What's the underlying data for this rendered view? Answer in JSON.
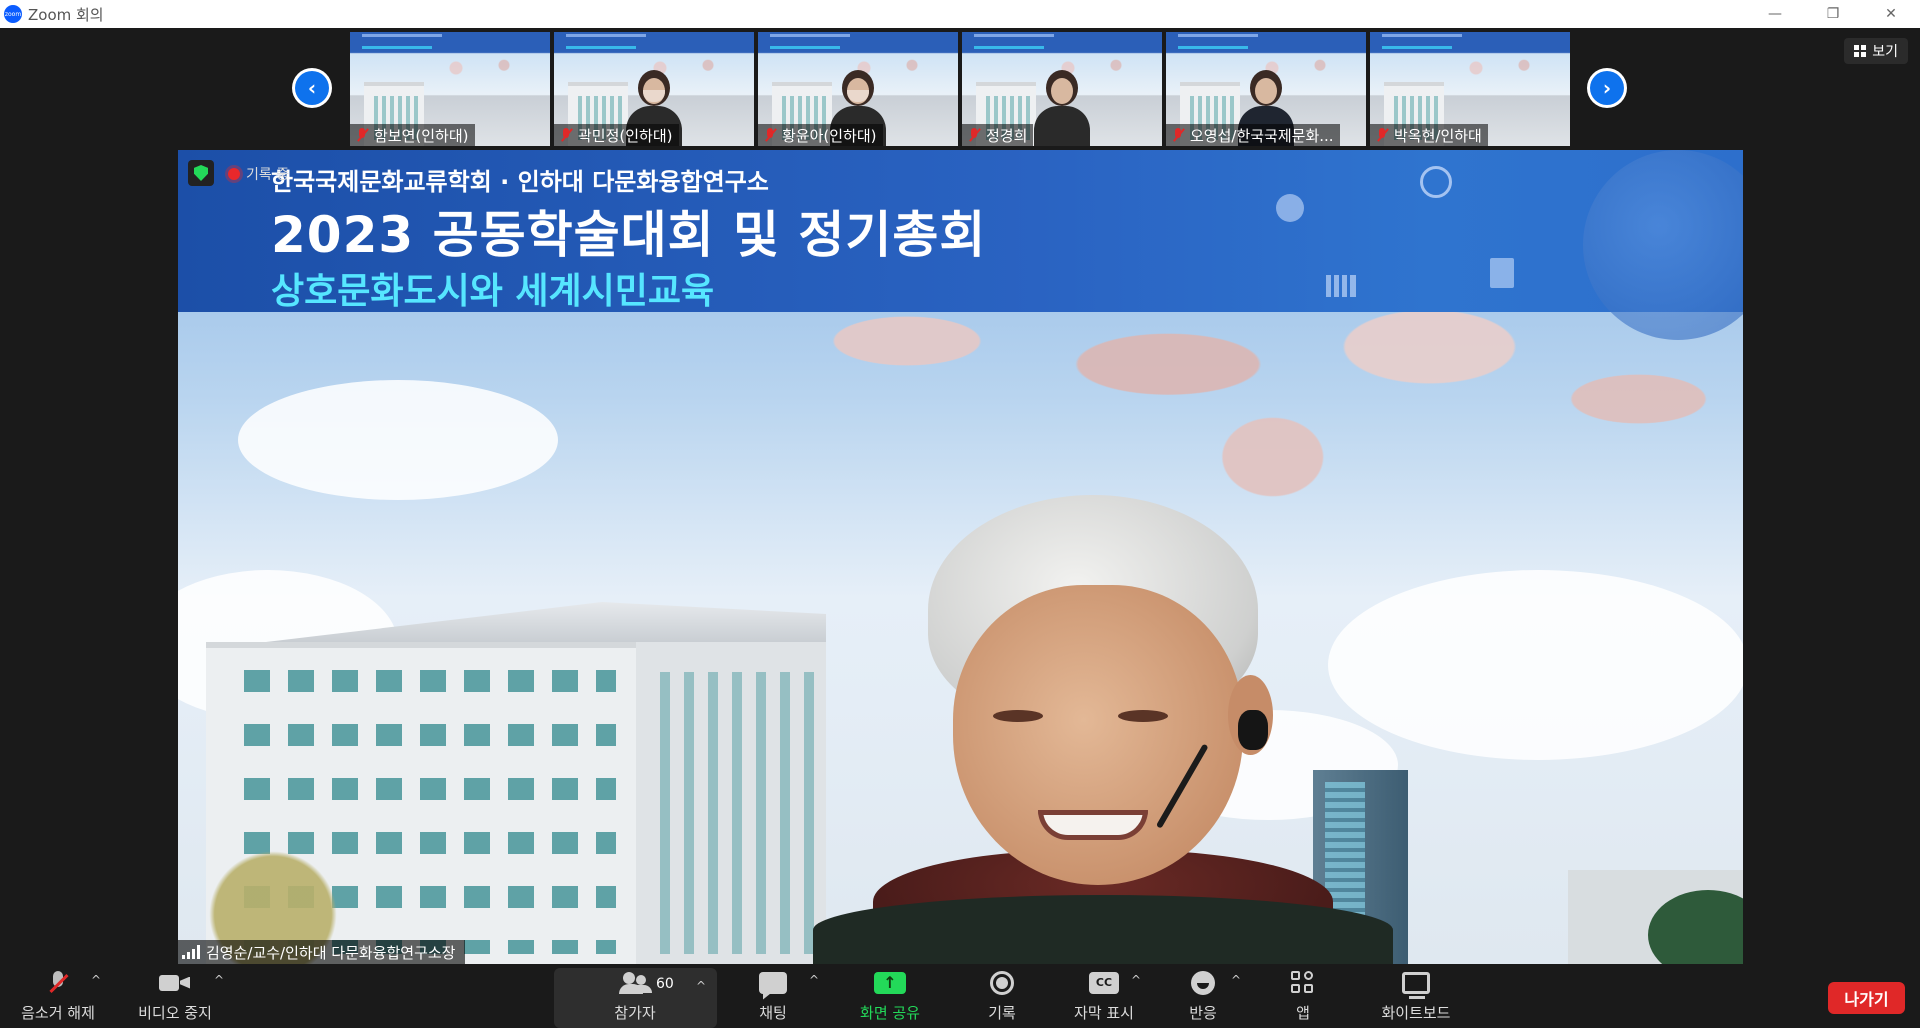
{
  "window": {
    "title": "Zoom 회의",
    "logo_text": "zoom",
    "minimize": "—",
    "restore": "❐",
    "close": "✕"
  },
  "gallery": {
    "prev_arrow": "‹",
    "next_arrow": "›",
    "participants": [
      {
        "name": "함보연(인하대)",
        "muted": true,
        "video": "banner"
      },
      {
        "name": "곽민정(인하대)",
        "muted": true,
        "video": "person-mask"
      },
      {
        "name": "황윤아(인하대)",
        "muted": true,
        "video": "person-mask"
      },
      {
        "name": "정경희",
        "muted": true,
        "video": "person"
      },
      {
        "name": "오영섭/한국국제문화...",
        "muted": true,
        "video": "person-suit"
      },
      {
        "name": "박옥현/인하대",
        "muted": true,
        "video": "banner"
      }
    ]
  },
  "view_button": {
    "label": "보기",
    "icon": "grid-icon"
  },
  "main_video": {
    "recording_label": "기록 중",
    "banner": {
      "line1": "한국국제문화교류학회 · 인하대 다문화융합연구소",
      "line2": "2023 공동학술대회 및 정기총회",
      "line3": "상호문화도시와 세계시민교육"
    },
    "speaker_name": "김영순/교수/인하대 다문화융합연구소장"
  },
  "toolbar": {
    "unmute_label": "음소거 해제",
    "video_label": "비디오 중지",
    "participants_label": "참가자",
    "participants_count": "60",
    "chat_label": "채팅",
    "share_label": "화면 공유",
    "record_label": "기록",
    "captions_label": "자막 표시",
    "captions_icon_text": "CC",
    "reactions_label": "반응",
    "apps_label": "앱",
    "whiteboard_label": "화이트보드",
    "leave_label": "나가기",
    "caret": "^"
  },
  "colors": {
    "accent_blue": "#0e72ed",
    "share_green": "#23d959",
    "leave_red": "#e02828",
    "muted_red": "#e02828"
  }
}
